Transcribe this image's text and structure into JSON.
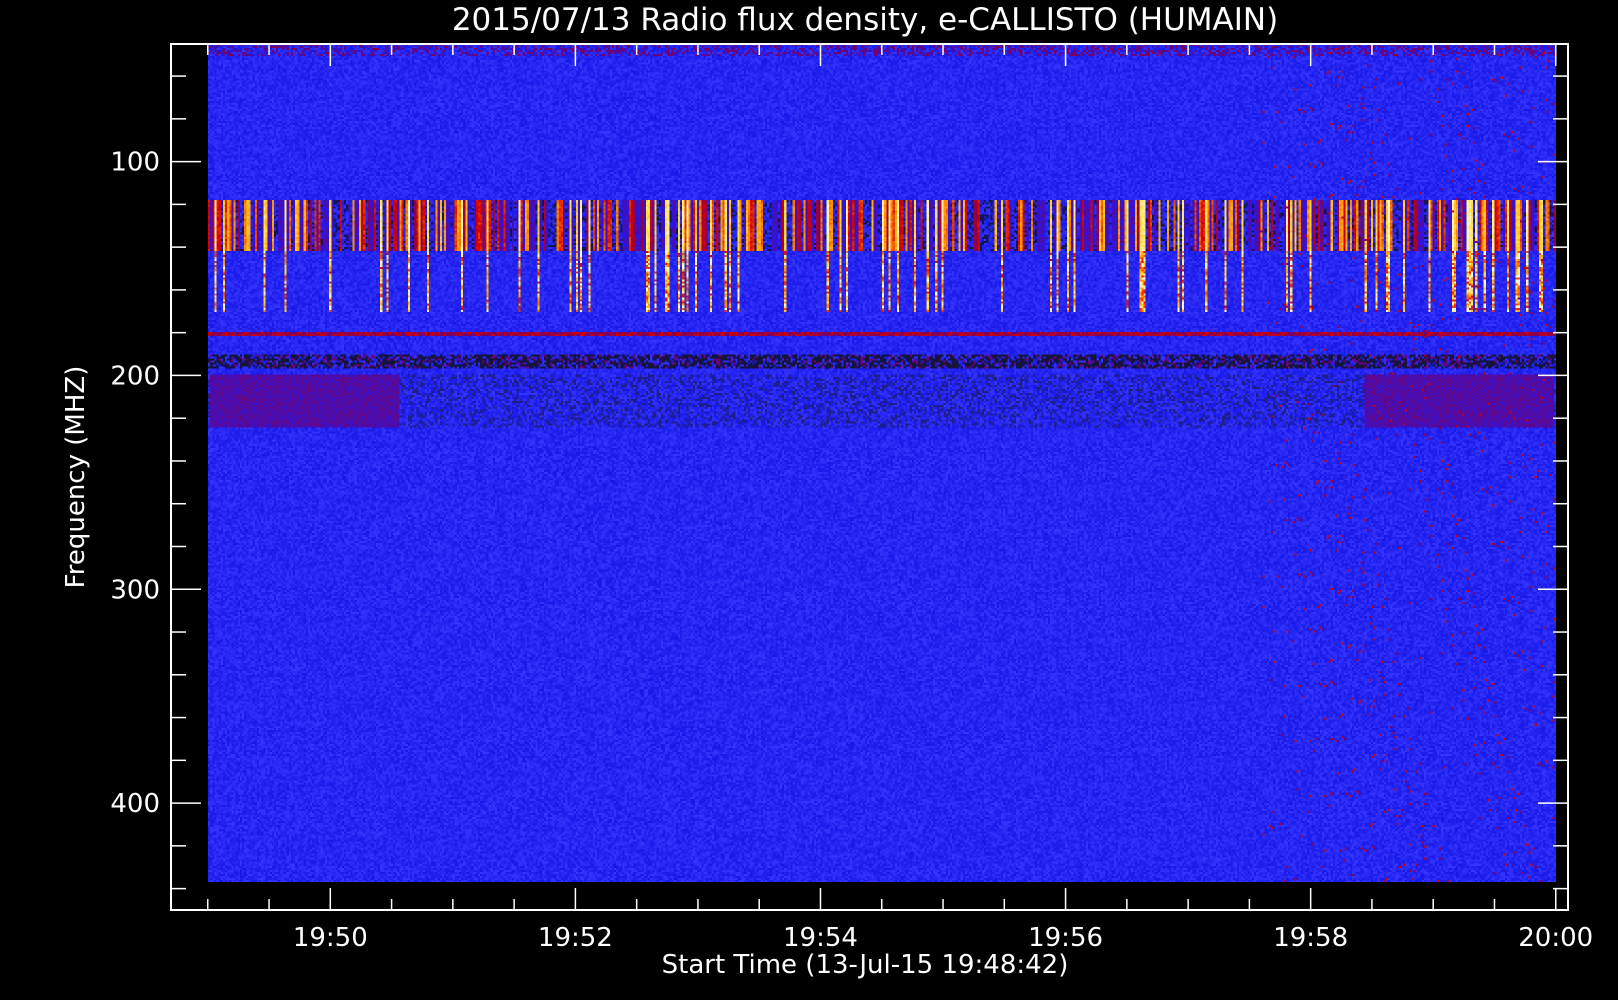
{
  "chart_data": {
    "type": "heatmap",
    "title": "2015/07/13  Radio flux density, e-CALLISTO (HUMAIN)",
    "xlabel": "Start Time (13-Jul-15 19:48:42)",
    "ylabel": "Frequency (MHZ)",
    "x_tick_labels": [
      "19:50",
      "19:52",
      "19:54",
      "19:56",
      "19:58",
      "20:00"
    ],
    "x_tick_values_min": [
      1,
      3,
      5,
      7,
      9,
      11
    ],
    "y_tick_labels": [
      "100",
      "200",
      "300",
      "400"
    ],
    "y_tick_values": [
      100,
      200,
      300,
      400
    ],
    "xlim_min": [
      -0.3,
      11.1
    ],
    "xlim_labels": [
      "19:48:42",
      "20:00:06"
    ],
    "ylim": [
      45,
      450
    ],
    "y_inverted": true,
    "data_extent": {
      "time_start_min": 0,
      "time_end_min": 11,
      "freq_min": 45,
      "freq_max": 437
    },
    "colormap": [
      "#000000",
      "#1a1aff",
      "#7a0060",
      "#d80000",
      "#ff8a00",
      "#ffe040",
      "#ffffff"
    ],
    "background_color": "#2626f2",
    "bands": [
      {
        "freq_lo": 45,
        "freq_hi": 50,
        "level": 0.25,
        "kind": "noisy-top"
      },
      {
        "freq_lo": 118,
        "freq_hi": 142,
        "level": 0.75,
        "kind": "bright-bursts"
      },
      {
        "freq_lo": 142,
        "freq_hi": 170,
        "level": 0.55,
        "kind": "spiky-lines"
      },
      {
        "freq_lo": 180,
        "freq_hi": 182,
        "level": 0.6,
        "kind": "thin-line"
      },
      {
        "freq_lo": 190,
        "freq_hi": 197,
        "level": 0.5,
        "kind": "dark-stripes"
      },
      {
        "freq_lo": 200,
        "freq_hi": 224,
        "level": 0.45,
        "kind": "patchy"
      }
    ]
  }
}
